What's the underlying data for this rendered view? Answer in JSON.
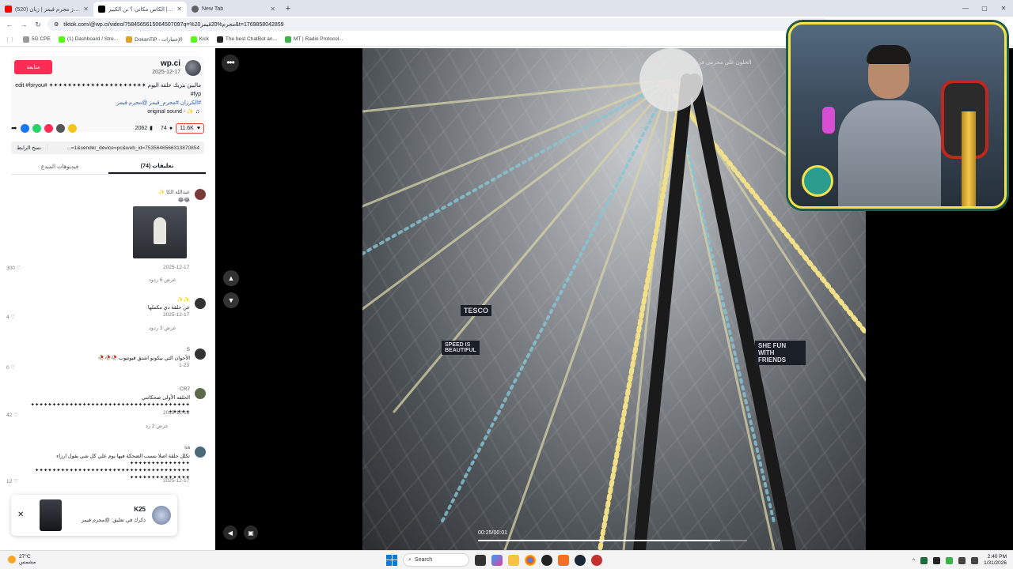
{
  "browser": {
    "tabs": [
      {
        "title": "(520) لحظة فوز مجرم قيمز | زيان",
        "color": "#ff0000",
        "active": false
      },
      {
        "title": "الكاس مكاني ؟ بن الكبير | TikTok على مجرم قيمز",
        "color": "#000000",
        "active": true
      },
      {
        "title": "New Tab",
        "color": "#5f6368",
        "active": false
      }
    ],
    "new_tab": "+",
    "url": "tiktok.com/@wp.ci/video/7584565615064507097q=%20مجرم%20قيمز&t=1769858042859",
    "bookmarks": [
      "5G CPE",
      "(1) Dashboard / Stre...",
      "DokanTiP - الإختبارات",
      "Kick",
      "The best ChatBot an...",
      "MT | Radio Protocol..."
    ]
  },
  "post": {
    "username": "wp.ci",
    "date": "2025-12-17",
    "follow_label": "متابعة",
    "caption": "مالبين بتزيك حلقة اليوم ✦✦✦✦✦✦✦✦✦✦✦✦✦✦✦✦✦✦✦✦✦ #edit #foryou #fyp",
    "tags": "#الكرزان #مجرم_قيمز @مجرم قيمز",
    "sound": "original sound - ✨",
    "likes": "11.6K",
    "comments": "74",
    "saves": "2062",
    "copy_link": "نسخ الرابط",
    "link": "...=1&sender_device=pc&web_id=7535646566313870854",
    "tab_comments": "تعليقات (74)",
    "tab_creator": "فيديوهات المبدع"
  },
  "comments": [
    {
      "name": "عبدالله الكا ✨",
      "text": "😂😂",
      "date": "2025-12-17",
      "likes": "300",
      "replies": "عرض 6 ردود",
      "has_image": true
    },
    {
      "name": "✨✨",
      "text": "عن حلقة دي مكملها",
      "date": "2025-12-17",
      "likes": "4",
      "replies": "عرض 3 ردود",
      "has_image": false
    },
    {
      "name": "S",
      "text": "الأحوان التي بيكونو اشتق قيوتيوب 🥀🥀🥀",
      "date": "1-23",
      "likes": "0",
      "replies": "",
      "has_image": false
    },
    {
      "name": "CR7",
      "text": "الحلقه الأولى ضحكاتني ✦✦✦✦✦✦✦✦✦✦✦✦✦✦✦✦✦✦✦✦✦✦✦✦✦✦✦✦✦✦✦✦✦✦✦✦✦ ✦✦✦✦✦",
      "date": "2025-12-18",
      "likes": "42",
      "replies": "عرض 2 رد",
      "has_image": false
    },
    {
      "name": "sa",
      "text": "تكلل حلقة اصلا بسبب الضحكة فيها يوم علي كل شي يقول ارزاء ✦✦✦✦✦✦✦✦✦✦✦✦✦✦ ✦✦✦✦✦✦✦✦✦✦✦✦✦✦✦✦✦✦✦✦✦✦✦✦✦✦✦✦✦✦✦✦✦✦✦✦ ✦✦✦✦✦✦✦✦✦✦✦✦✦✦",
      "date": "2025-12-17",
      "likes": "12",
      "replies": "",
      "has_image": false
    }
  ],
  "toast": {
    "name": "K25",
    "message": "ذكرك في تعليق: @مجرم قيمز",
    "close": "✕"
  },
  "video": {
    "overlay_text": "الخلون على مجرمي في سنة",
    "timecode": "00:25/00:01",
    "progress": 0.9,
    "signs": [
      "TESCO",
      "SPEED IS BEAUTIFUL",
      "SHE FUN WITH FRIENDS"
    ],
    "more": "•••"
  },
  "taskbar": {
    "temperature": "27°C",
    "weather_desc": "مشمس",
    "search": "Search",
    "time": "2:40 PM",
    "date": "1/31/2026"
  }
}
